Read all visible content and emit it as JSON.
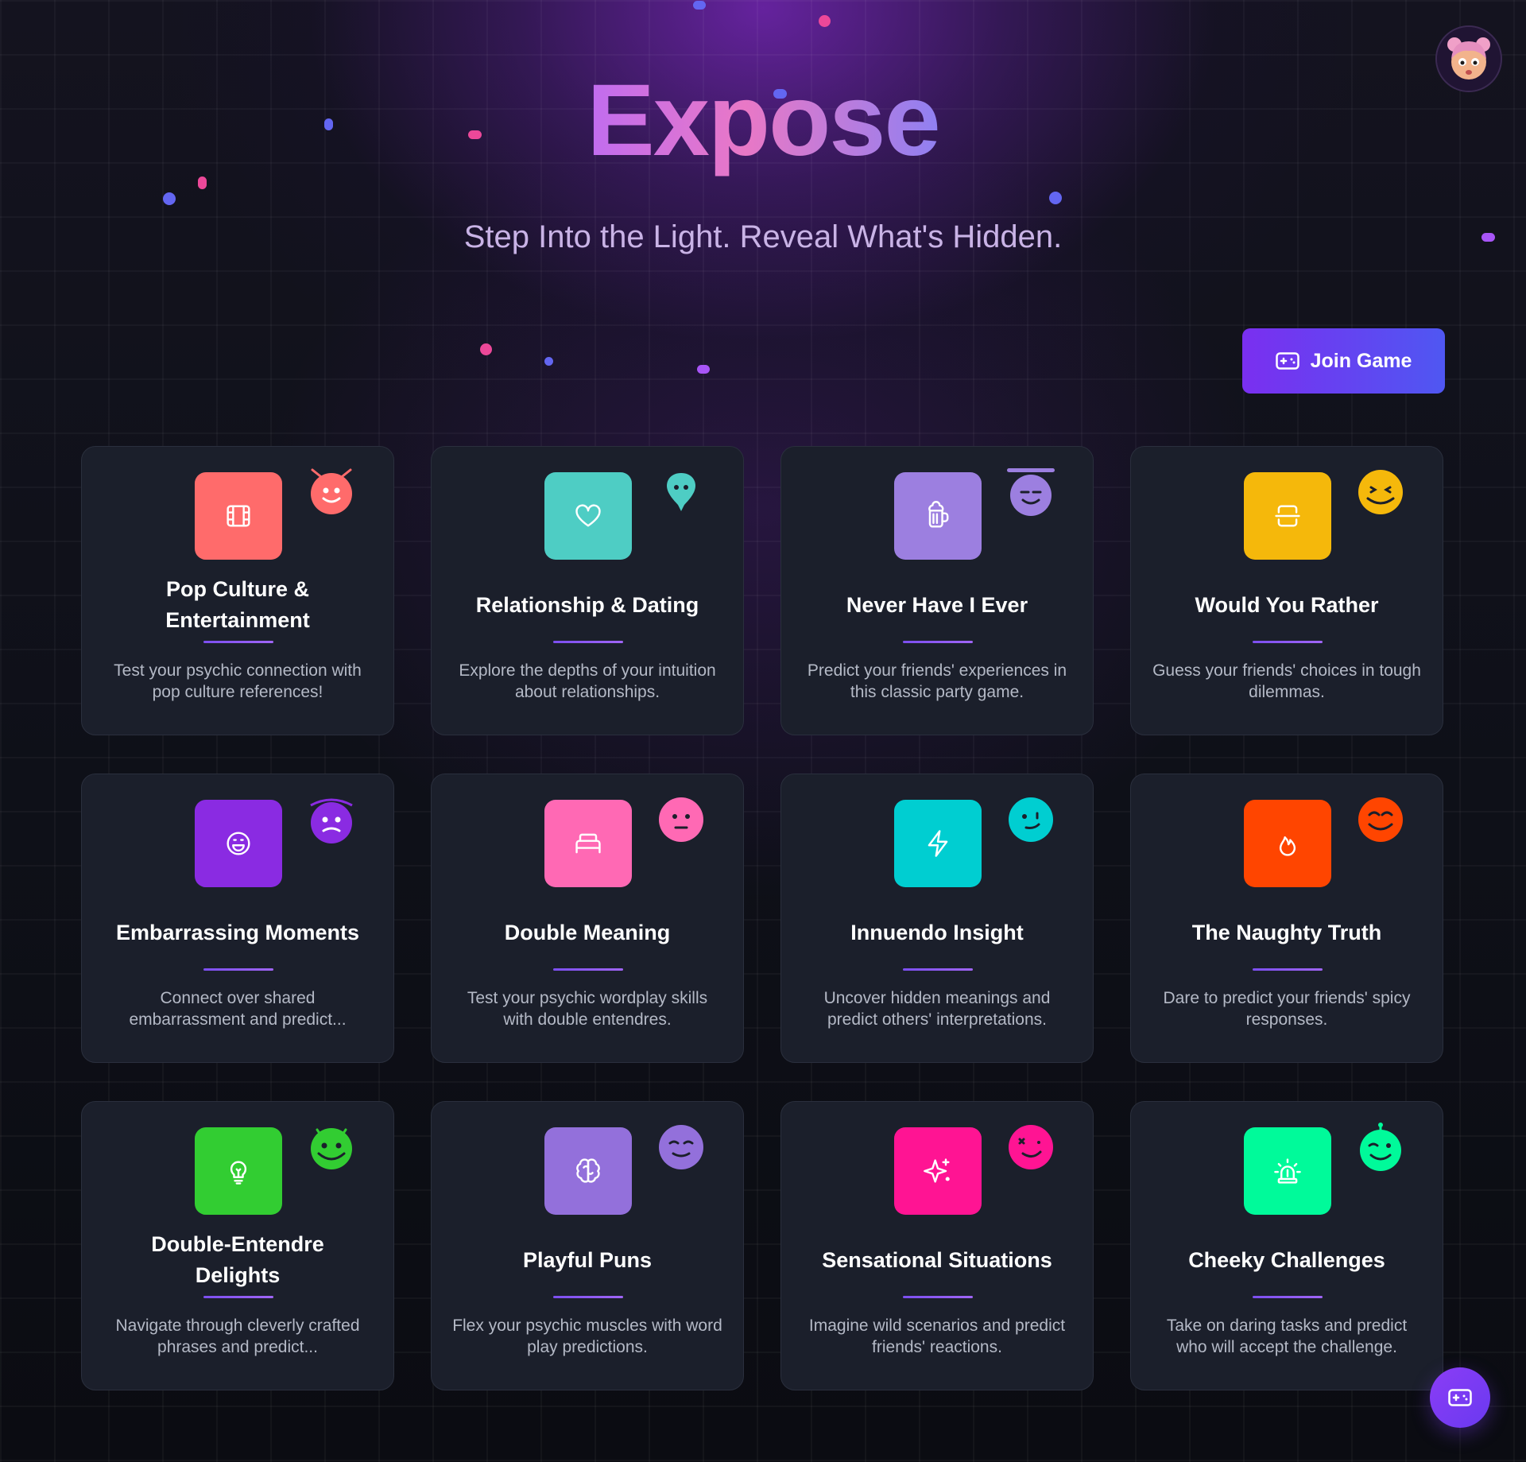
{
  "app": {
    "title": "Expose",
    "subtitle": "Step Into the Light. Reveal What's Hidden."
  },
  "header": {
    "avatar_icon": "cartoon-avatar-icon",
    "join_button_label": "Join Game",
    "join_button_icon": "gamepad-icon"
  },
  "categories": [
    {
      "title": "Pop Culture & Entertainment",
      "description": "Test your psychic connection with pop culture references!",
      "icon": "film-icon",
      "color": "#ff6b6b",
      "emoji": "antenna-smile-face-icon"
    },
    {
      "title": "Relationship & Dating",
      "description": "Explore the depths of your intuition about relationships.",
      "icon": "heart-icon",
      "color": "#4ecdc4",
      "emoji": "alien-face-icon"
    },
    {
      "title": "Never Have I Ever",
      "description": "Predict your friends' experiences in this classic party game.",
      "icon": "beer-mug-icon",
      "color": "#9c7fe0",
      "emoji": "halo-smile-face-icon"
    },
    {
      "title": "Would You Rather",
      "description": "Guess your friends' choices in tough dilemmas.",
      "icon": "split-square-icon",
      "color": "#f5b80b",
      "emoji": "squint-face-icon"
    },
    {
      "title": "Embarrassing Moments",
      "description": "Connect over shared embarrassment and predict...",
      "icon": "laugh-face-icon",
      "color": "#8a2be2",
      "emoji": "worried-face-icon"
    },
    {
      "title": "Double Meaning",
      "description": "Test your psychic wordplay skills with double entendres.",
      "icon": "bed-icon",
      "color": "#ff69b4",
      "emoji": "neutral-face-icon"
    },
    {
      "title": "Innuendo Insight",
      "description": "Uncover hidden meanings and predict others' interpretations.",
      "icon": "lightning-icon",
      "color": "#00ced1",
      "emoji": "smirk-face-icon"
    },
    {
      "title": "The Naughty Truth",
      "description": "Dare to predict your friends' spicy responses.",
      "icon": "flame-icon",
      "color": "#ff4500",
      "emoji": "grin-face-icon"
    },
    {
      "title": "Double-Entendre Delights",
      "description": "Navigate through cleverly crafted phrases and predict...",
      "icon": "lightbulb-icon",
      "color": "#32cd32",
      "emoji": "big-smile-face-icon"
    },
    {
      "title": "Playful Puns",
      "description": "Flex your psychic muscles with word play predictions.",
      "icon": "brain-icon",
      "color": "#9370db",
      "emoji": "content-face-icon"
    },
    {
      "title": "Sensational Situations",
      "description": "Imagine wild scenarios and predict friends' reactions.",
      "icon": "sparkles-icon",
      "color": "#ff1493",
      "emoji": "wink-face-icon"
    },
    {
      "title": "Cheeky Challenges",
      "description": "Take on daring tasks and predict who will accept the challenge.",
      "icon": "alarm-siren-icon",
      "color": "#00fa9a",
      "emoji": "antenna-wink-face-icon"
    }
  ],
  "fab": {
    "icon": "gamepad-icon"
  }
}
